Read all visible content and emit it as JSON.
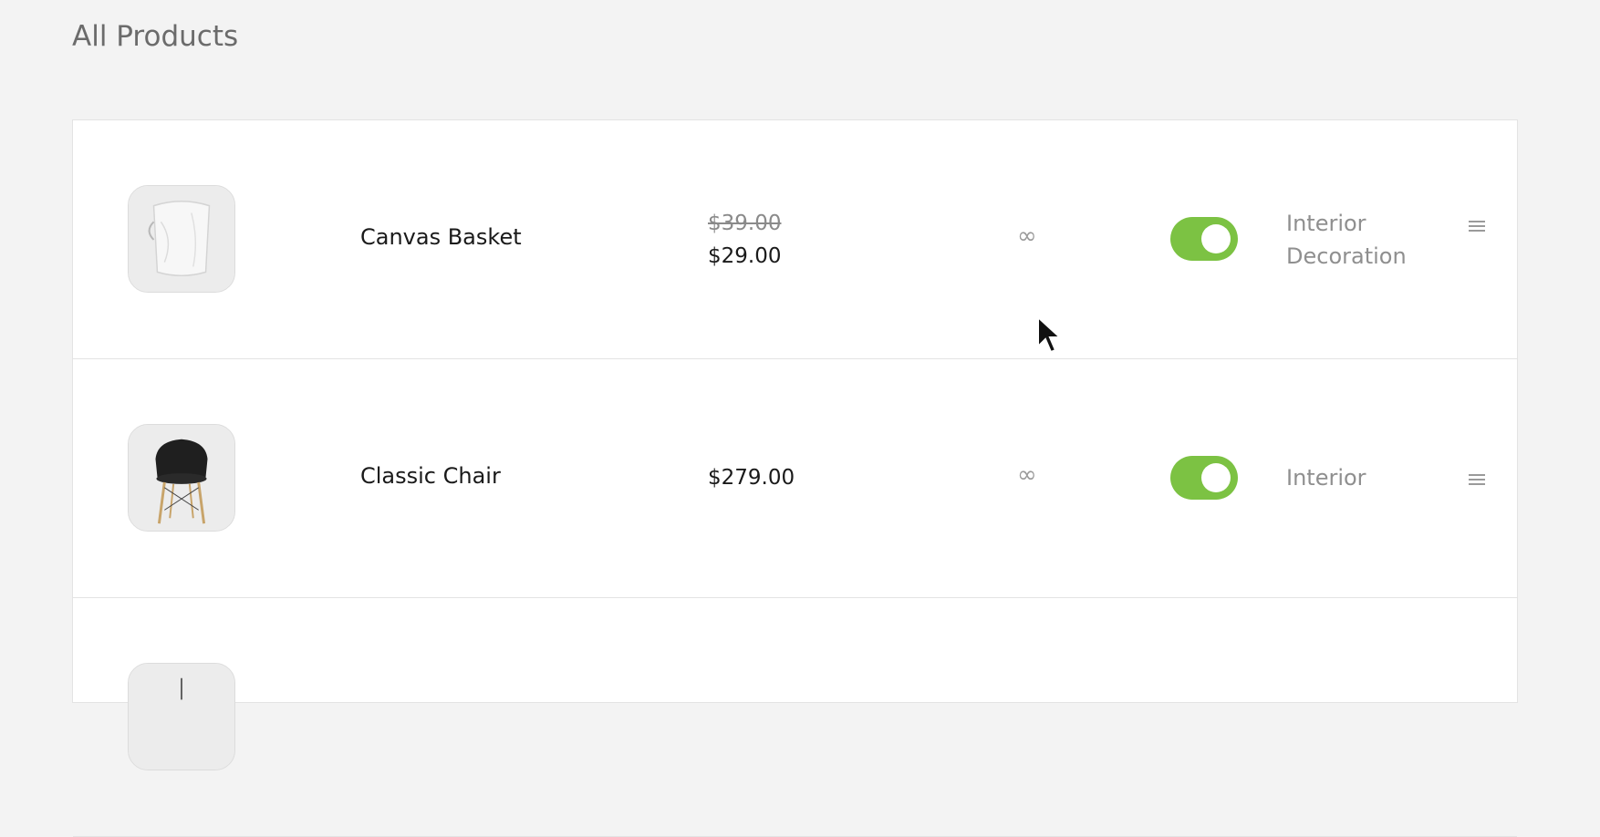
{
  "page": {
    "title": "All Products"
  },
  "products": [
    {
      "name": "Canvas Basket",
      "old_price": "$39.00",
      "price": "$29.00",
      "stock": "∞",
      "enabled": true,
      "category": "Interior Decoration",
      "image_icon": "canvas-basket-image"
    },
    {
      "name": "Classic Chair",
      "old_price": "",
      "price": "$279.00",
      "stock": "∞",
      "enabled": true,
      "category": "Interior",
      "image_icon": "classic-chair-image"
    }
  ],
  "colors": {
    "toggle_on": "#7cc243",
    "background": "#f3f3f3",
    "panel": "#ffffff"
  }
}
